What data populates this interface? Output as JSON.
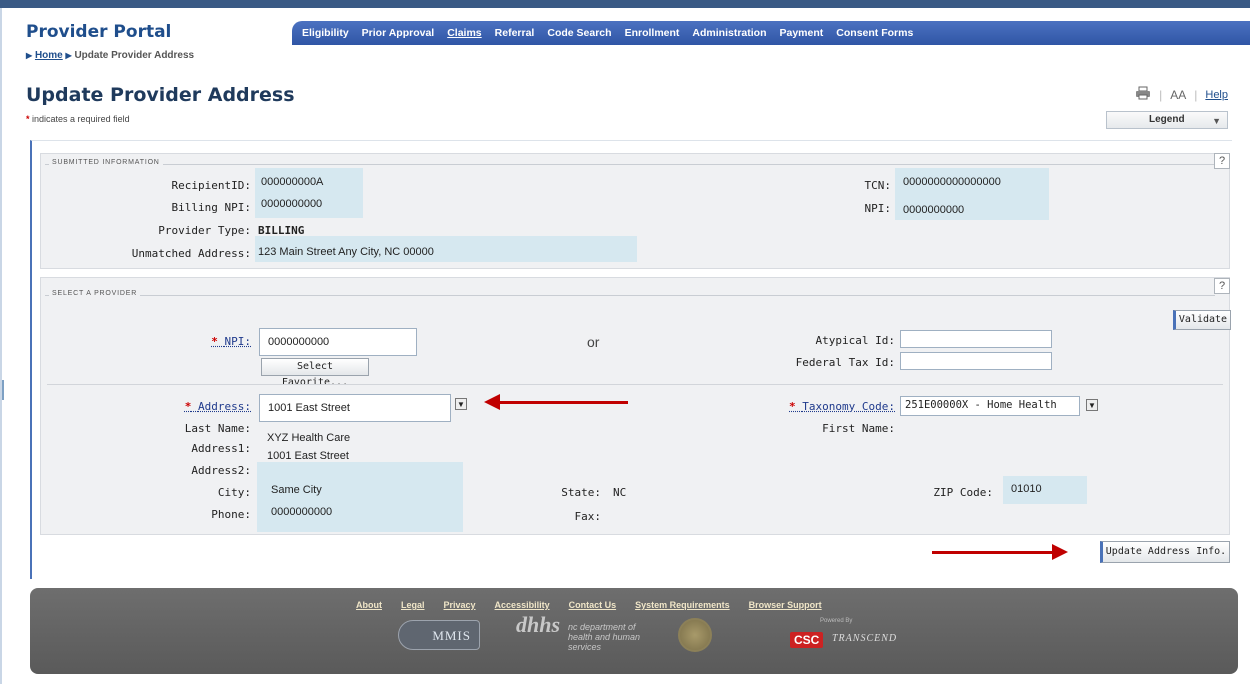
{
  "header": {
    "portal_title": "Provider Portal",
    "nav": [
      "Eligibility",
      "Prior Approval",
      "Claims",
      "Referral",
      "Code Search",
      "Enrollment",
      "Administration",
      "Payment",
      "Consent Forms"
    ],
    "breadcrumb": {
      "home": "Home",
      "current": "Update Provider Address"
    }
  },
  "page": {
    "title": "Update Provider Address",
    "required_note": "indicates a required field",
    "required_star": "*",
    "tools": {
      "print_icon": "printer-icon",
      "font_size": "AA",
      "help": "Help"
    },
    "legend_label": "Legend"
  },
  "submitted": {
    "legend": "Submitted Information",
    "help": "?",
    "recipient_id_label": "RecipientID:",
    "recipient_id": "000000000A",
    "billing_npi_label": "Billing NPI:",
    "billing_npi": "0000000000",
    "provider_type_label": "Provider Type:",
    "provider_type": "BILLING",
    "unmatched_label": "Unmatched Address:",
    "unmatched": "123 Main Street Any City, NC 00000",
    "tcn_label": "TCN:",
    "tcn": "0000000000000000",
    "npi_label": "NPI:",
    "npi": "0000000000"
  },
  "select_provider": {
    "legend": "Select a Provider",
    "help": "?",
    "validate": "Validate",
    "npi_label": "NPI:",
    "npi_value": "0000000000",
    "select_favorite": "Select Favorite...",
    "or": "or",
    "atypical_label": "Atypical Id:",
    "atypical_value": "",
    "fedtax_label": "Federal Tax Id:",
    "fedtax_value": "",
    "address_label": "Address:",
    "address_value": "1001 East Street",
    "taxonomy_label": "Taxonomy Code:",
    "taxonomy_value": "251E00000X - Home Health",
    "last_name_label": "Last Name:",
    "last_name": "XYZ Health Care",
    "first_name_label": "First Name:",
    "first_name": "",
    "address1_label": "Address1:",
    "address1": "1001 East Street",
    "address2_label": "Address2:",
    "address2": "",
    "city_label": "City:",
    "city": "Same City",
    "state_label": "State:",
    "state": "NC",
    "zip_label": "ZIP Code:",
    "zip": "01010",
    "phone_label": "Phone:",
    "phone": "0000000000",
    "fax_label": "Fax:",
    "fax": ""
  },
  "actions": {
    "update": "Update Address Info."
  },
  "footer": {
    "links": [
      "About",
      "Legal",
      "Privacy",
      "Accessibility",
      "Contact Us",
      "System Requirements",
      "Browser Support"
    ],
    "mmis": "MMIS",
    "dhhs_text": "nc department of health and human services",
    "powered_by": "Powered By",
    "csc": "CSC",
    "transcend": "TRANSCEND"
  },
  "colors": {
    "accent": "#2f55a5",
    "required": "#cc0000",
    "arrow": "#c00000",
    "value_bg": "#d6e8f0"
  }
}
